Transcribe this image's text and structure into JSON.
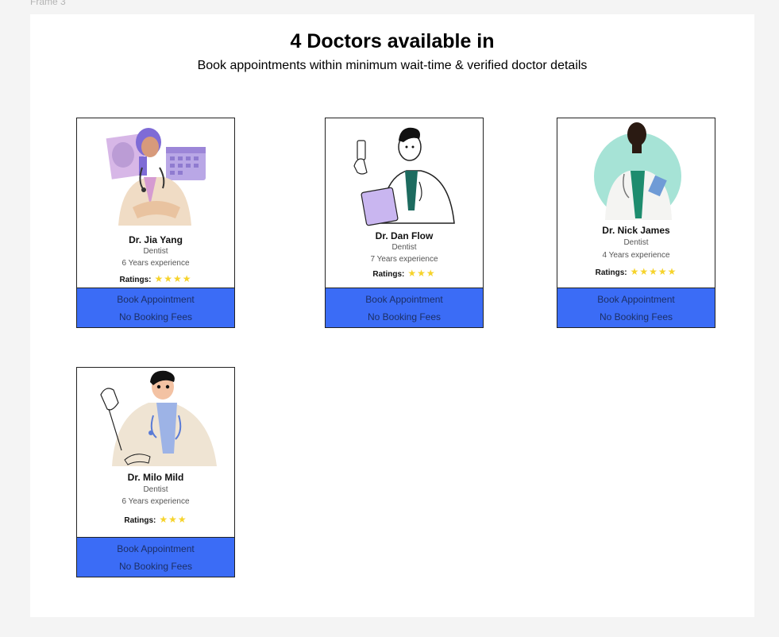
{
  "frame": {
    "label": "Frame 3"
  },
  "header": {
    "title": "4 Doctors available in",
    "subtitle": "Book appointments within minimum wait-time & verified doctor details"
  },
  "ratings_label": "Ratings:",
  "doctors": [
    {
      "name": "Dr. Jia Yang",
      "specialty": "Dentist",
      "experience": "6 Years experience",
      "stars": "★★★★",
      "rating": 4,
      "book_label": "Book Appointment",
      "fee_label": "No Booking Fees"
    },
    {
      "name": "Dr. Dan Flow",
      "specialty": "Dentist",
      "experience": "7 Years experience",
      "stars": "★★★",
      "rating": 3,
      "book_label": "Book Appointment",
      "fee_label": "No Booking Fees"
    },
    {
      "name": "Dr. Nick James",
      "specialty": "Dentist",
      "experience": "4 Years experience",
      "stars": "★★★★★",
      "rating": 5,
      "book_label": "Book Appointment",
      "fee_label": "No Booking Fees"
    },
    {
      "name": "Dr. Milo Mild",
      "specialty": "Dentist",
      "experience": "6 Years experience",
      "stars": "★★★",
      "rating": 3,
      "book_label": "Book Appointment",
      "fee_label": "No Booking Fees"
    }
  ],
  "colors": {
    "cta": "#3b6cf6",
    "star": "#f6d32b",
    "frame": "#ffffff",
    "canvas": "#f4f4f4"
  }
}
